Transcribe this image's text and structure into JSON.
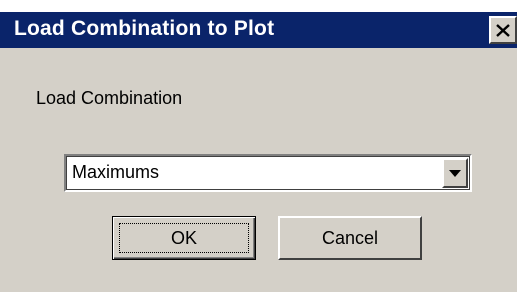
{
  "window": {
    "title": "Load Combination to Plot"
  },
  "form": {
    "label": "Load Combination",
    "combo_value": "Maximums"
  },
  "buttons": {
    "ok_label": "OK",
    "cancel_label": "Cancel"
  },
  "icons": {
    "close": "close-icon",
    "dropdown": "chevron-down-icon"
  },
  "colors": {
    "title_bar": "#0a246a",
    "dialog_face": "#d4d0c8"
  }
}
